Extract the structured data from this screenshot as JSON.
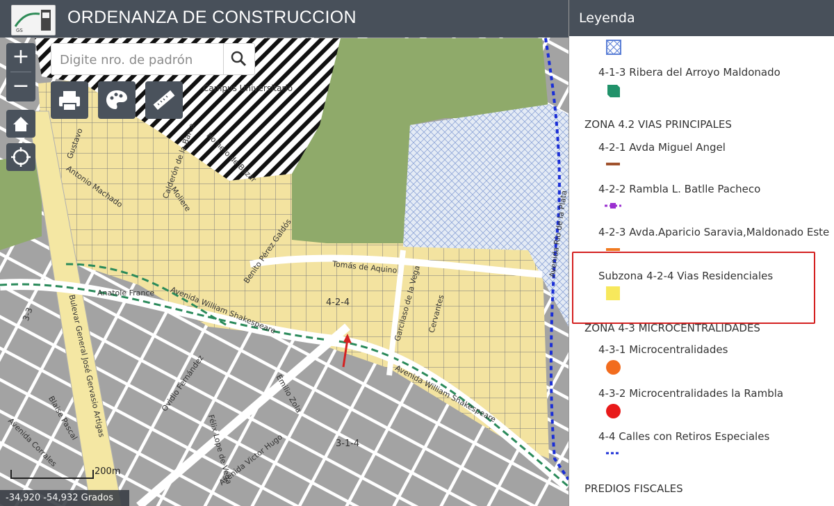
{
  "header": {
    "title": "ORDENANZA DE CONSTRUCCION"
  },
  "search": {
    "placeholder": "Digite nro. de padrón"
  },
  "zoom": {
    "in_label": "+",
    "out_label": "−"
  },
  "map": {
    "scale_label": "200m",
    "coordinates": "-34,920 -54,932 Grados",
    "zone_labels": {
      "z424": "4-2-4",
      "z314": "3-1-4",
      "z33": "3-3"
    },
    "street_labels": {
      "campus": "Campus Universitario",
      "tomas": "Tomás de Aquino",
      "antonio": "Antonio Machado",
      "calderon": "Calderón de la Barca",
      "moliere": "Moliere",
      "homero": "Homero de Bazar",
      "benito": "Benito Pérez Galdós",
      "anatole": "Anatole France",
      "shakespeare": "Avenida William Shakespeare",
      "shakespeare2": "Avenida William Shakespeare",
      "artigas": "Bulevar General José Gervasio Artigas",
      "ovidio": "Ovidio Fernández",
      "victor": "Avenida Victor Hugo",
      "blaise": "Blaise Pascal",
      "felix": "Félix Lope de Vega",
      "emilio": "Emilio Zola",
      "garcilaso": "Garcilaso de la Vega",
      "cervantes": "Cervantes",
      "gustavo": "Gustavo",
      "corrales": "Avenida Corrales",
      "avenida_rio": "Avenida Río de la Plata"
    }
  },
  "legend": {
    "title": "Leyenda",
    "items": [
      "4-1-3 Ribera del Arroyo Maldonado",
      "ZONA 4.2 VIAS PRINCIPALES",
      "4-2-1 Avda Miguel Angel",
      "4-2-2 Rambla L. Batlle Pacheco",
      "4-2-3 Avda.Aparicio Saravia,Maldonado Este",
      "Subzona 4-2-4 Vias Residenciales",
      "ZONA 4-3 MICROCENTRALIDADES",
      "4-3-1 Microcentralidades",
      "4-3-2 Microcentralidades la Rambla",
      "4-4 Calles con Retiros Especiales",
      "PREDIOS FISCALES"
    ],
    "colors": {
      "blue_hatch": "#5b7fd6",
      "green_ribera": "#21926a",
      "miguel_angel": "#a0522d",
      "rambla": "#9b30d0",
      "aparicio": "#f07a20",
      "residencial": "#f7e85c",
      "micro": "#f26c1e",
      "micro_rambla": "#e81a1a",
      "retiros": "#1b2fd6",
      "highlight": "#d42020"
    }
  }
}
